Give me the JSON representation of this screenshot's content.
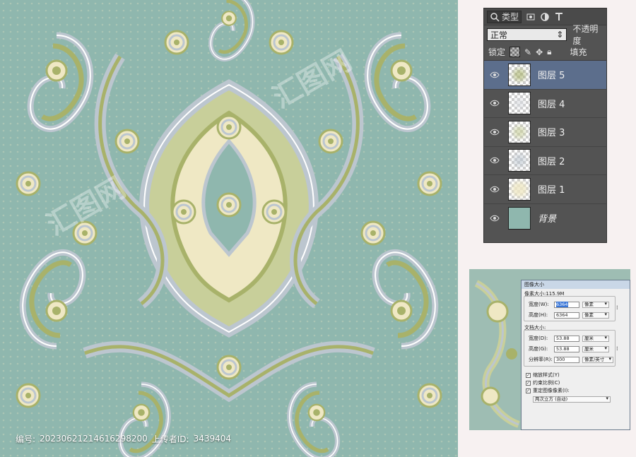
{
  "layers_panel": {
    "filter_label": "类型",
    "blend_mode": "正常",
    "opacity_label": "不透明度",
    "lock_label": "锁定",
    "fill_label": "填充",
    "layers": [
      {
        "name": "图层 5",
        "selected": true
      },
      {
        "name": "图层 4",
        "selected": false
      },
      {
        "name": "图层 3",
        "selected": false
      },
      {
        "name": "图层 2",
        "selected": false
      },
      {
        "name": "图层 1",
        "selected": false
      },
      {
        "name": "背景",
        "selected": false
      }
    ]
  },
  "image_size_dialog": {
    "title": "图像大小",
    "pixel_dimensions": "像素大小:115.9M",
    "width_label": "宽度(W):",
    "width_value": "6364",
    "height_label": "高度(H):",
    "height_value": "6364",
    "pixel_unit": "像素",
    "doc_size_label": "文档大小:",
    "doc_width_label": "宽度(D):",
    "doc_width_value": "53.88",
    "doc_height_label": "高度(G):",
    "doc_height_value": "53.88",
    "cm_unit": "厘米",
    "resolution_label": "分辨率(R):",
    "resolution_value": "300",
    "resolution_unit": "像素/英寸",
    "scale_styles": "缩放样式(Y)",
    "constrain_proportions": "约束比例(C)",
    "resample": "重定图像像素(I):",
    "resample_method": "两次立方 (自动)"
  },
  "footer": {
    "id_label": "编号:",
    "id_value": "20230621214616298200",
    "uploader_label": "上传者ID:",
    "uploader_value": "3439404"
  },
  "colors": {
    "background_teal": "#8fb7ae",
    "olive": "#a8b26a",
    "cream": "#efe8c4",
    "lilac_grey": "#bcc6cf"
  }
}
